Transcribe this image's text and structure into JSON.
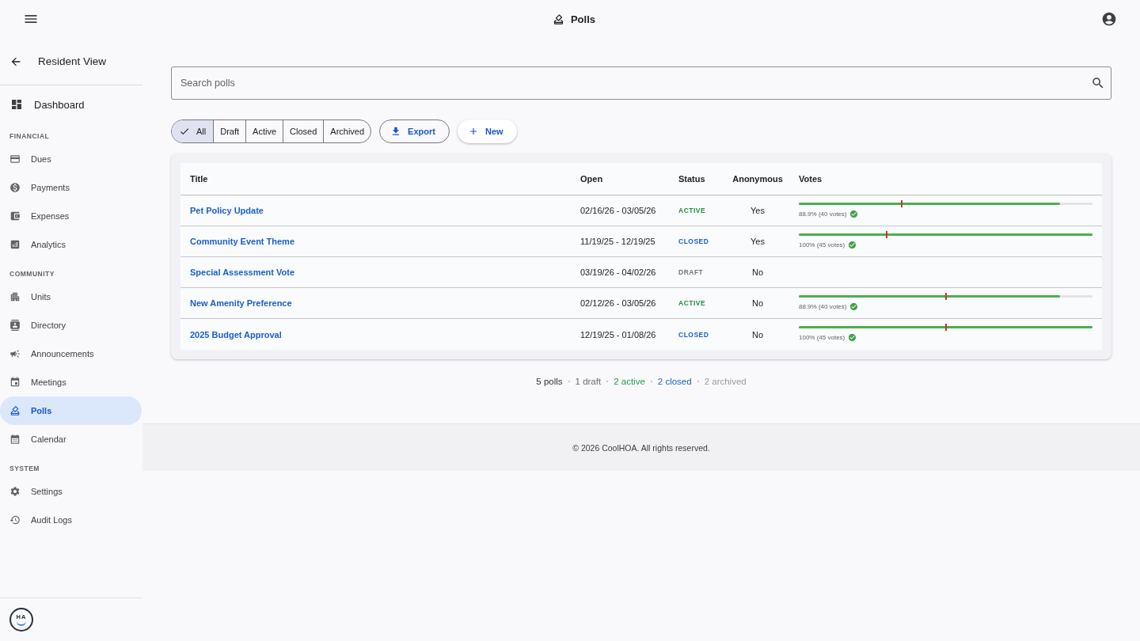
{
  "app_bar": {
    "title": "Polls"
  },
  "sidebar": {
    "back_link": {
      "label": "Resident View"
    },
    "home": {
      "label": "Dashboard",
      "selected": false
    },
    "sections": [
      {
        "heading": "FINANCIAL",
        "items": [
          {
            "label": "Dues",
            "selected": false
          },
          {
            "label": "Payments",
            "selected": false
          },
          {
            "label": "Expenses",
            "selected": false
          },
          {
            "label": "Analytics",
            "selected": false
          }
        ]
      },
      {
        "heading": "COMMUNITY",
        "items": [
          {
            "label": "Units",
            "selected": false
          },
          {
            "label": "Directory",
            "selected": false
          },
          {
            "label": "Announcements",
            "selected": false
          },
          {
            "label": "Meetings",
            "selected": false
          },
          {
            "label": "Polls",
            "selected": true
          },
          {
            "label": "Calendar",
            "selected": false
          }
        ]
      },
      {
        "heading": "SYSTEM",
        "items": [
          {
            "label": "Settings",
            "selected": false
          },
          {
            "label": "Audit Logs",
            "selected": false
          }
        ]
      }
    ],
    "logo": {
      "text": "HA"
    }
  },
  "search": {
    "placeholder": "Search polls"
  },
  "filters": [
    {
      "label": "All",
      "selected": true
    },
    {
      "label": "Draft",
      "selected": false
    },
    {
      "label": "Active",
      "selected": false
    },
    {
      "label": "Closed",
      "selected": false
    },
    {
      "label": "Archived",
      "selected": false
    }
  ],
  "actions": [
    {
      "label": "Export",
      "kind": "outlined"
    },
    {
      "label": "New",
      "kind": "raised"
    }
  ],
  "table": {
    "columns": [
      "Title",
      "Open",
      "Status",
      "Anonymous",
      "Votes"
    ],
    "rows": [
      {
        "title": "Pet Policy Update",
        "open": "02/16/26 - 03/05/26",
        "status": {
          "label": "ACTIVE",
          "color": "#1e8e3e"
        },
        "anonymous": "Yes",
        "votes": {
          "level": 0.889,
          "reading": "88.9% (40 votes)",
          "passed": true,
          "quorum": {
            "level": 0.35
          }
        }
      },
      {
        "title": "Community Event Theme",
        "open": "11/19/25 - 12/19/25",
        "status": {
          "label": "CLOSED",
          "color": "#1a5fc9"
        },
        "anonymous": "Yes",
        "votes": {
          "level": 1,
          "reading": "100% (45 votes)",
          "passed": true,
          "quorum": {
            "level": 0.3
          }
        }
      },
      {
        "title": "Special Assessment Vote",
        "open": "03/19/26 - 04/02/26",
        "status": {
          "label": "DRAFT",
          "color": "#757575"
        },
        "anonymous": "No"
      },
      {
        "title": "New Amenity Preference",
        "open": "02/12/26 - 03/05/26",
        "status": {
          "label": "ACTIVE",
          "color": "#1e8e3e"
        },
        "anonymous": "No",
        "votes": {
          "level": 0.889,
          "reading": "88.9% (40 votes)",
          "passed": true,
          "quorum": {
            "level": 0.5
          }
        }
      },
      {
        "title": "2025 Budget Approval",
        "open": "12/19/25 - 01/08/26",
        "status": {
          "label": "CLOSED",
          "color": "#1a5fc9"
        },
        "anonymous": "No",
        "votes": {
          "level": 1,
          "reading": "100% (45 votes)",
          "passed": true,
          "quorum": {
            "level": 0.5
          }
        }
      }
    ]
  },
  "summary": [
    {
      "text": "5 polls",
      "color": "#333333"
    },
    {
      "text": "1 draft",
      "color": "#6b6b6b"
    },
    {
      "text": "2 active",
      "color": "#1e9e44"
    },
    {
      "text": "2 closed",
      "color": "#1a5fc9"
    },
    {
      "text": "2 archived",
      "color": "#9a9a9a"
    }
  ],
  "footer": {
    "text": "© 2026 CoolHOA. All rights reserved."
  }
}
